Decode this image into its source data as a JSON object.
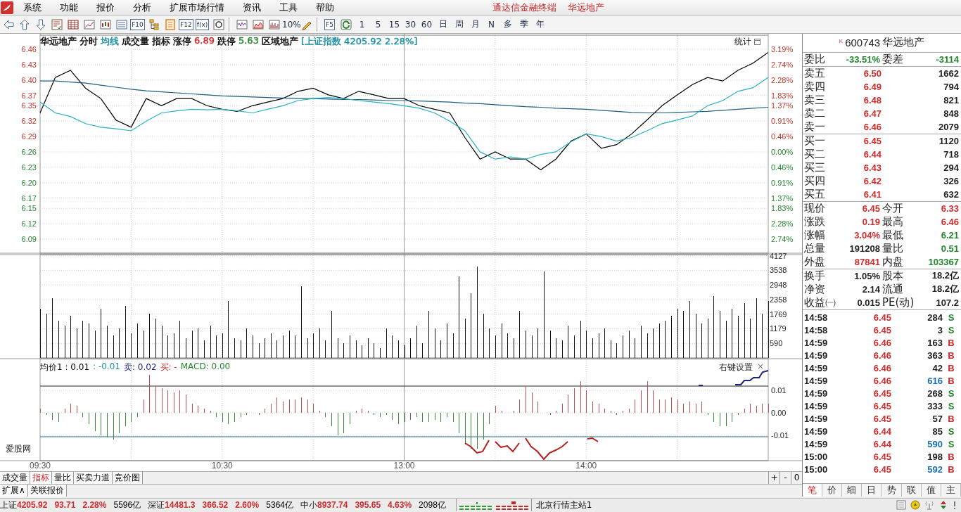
{
  "menubar": {
    "menus": [
      "系统",
      "功能",
      "报价",
      "分析",
      "扩展市场行情",
      "资讯",
      "工具",
      "帮助"
    ],
    "title": "通达信金融终端",
    "security": "华远地产"
  },
  "toolbar": {
    "items": [
      {
        "kind": "icon"
      },
      {
        "kind": "icon"
      },
      {
        "kind": "icon"
      },
      {
        "kind": "icon"
      },
      {
        "kind": "icon"
      },
      {
        "kind": "icon"
      },
      {
        "kind": "icon"
      },
      {
        "kind": "icon"
      },
      {
        "kind": "boxed",
        "text": "F10"
      },
      {
        "kind": "icon"
      },
      {
        "kind": "icon"
      },
      {
        "kind": "boxed",
        "text": "F12"
      },
      {
        "kind": "boxed",
        "text": "f(x)"
      },
      {
        "kind": "icon"
      },
      {
        "kind": "separator"
      },
      {
        "kind": "icon"
      },
      {
        "kind": "icon"
      },
      {
        "kind": "icon"
      },
      {
        "kind": "text",
        "text": "10%"
      },
      {
        "kind": "icon"
      },
      {
        "kind": "separator"
      },
      {
        "kind": "boxed",
        "text": "F5"
      },
      {
        "kind": "icon"
      },
      {
        "kind": "text",
        "text": "1"
      },
      {
        "kind": "text",
        "text": "5"
      },
      {
        "kind": "text",
        "text": "15"
      },
      {
        "kind": "text",
        "text": "30"
      },
      {
        "kind": "text",
        "text": "60"
      },
      {
        "kind": "text",
        "text": "日"
      },
      {
        "kind": "text",
        "text": "周"
      },
      {
        "kind": "text",
        "text": "月"
      },
      {
        "kind": "text",
        "text": "N"
      },
      {
        "kind": "text",
        "text": "多"
      },
      {
        "kind": "text",
        "text": "季"
      },
      {
        "kind": "text",
        "text": "年"
      }
    ]
  },
  "chart": {
    "header": [
      {
        "text": "华远地产"
      },
      {
        "text": "分时"
      },
      {
        "text": "均线",
        "color": "#1a8fa0"
      },
      {
        "text": "成交量"
      },
      {
        "text": "指标"
      },
      {
        "text": "涨停"
      },
      {
        "text": "6.89",
        "color": "#d02c2c"
      },
      {
        "text": "跌停"
      },
      {
        "text": "5.63",
        "color": "#23862d"
      },
      {
        "text": "区域地产"
      },
      {
        "text": "[上证指数 4205.92 2.28%]",
        "color": "#1a8fa0"
      }
    ],
    "stats_button": "统计",
    "price_chart": {
      "chart_data": {
        "type": "line",
        "grid": true,
        "ylim": [
          6.0626,
          6.4874
        ],
        "yticks": [
          {
            "value": 6.46,
            "label": "6.46"
          },
          {
            "value": 6.43,
            "label": "6.43"
          },
          {
            "value": 6.4,
            "label": "6.40"
          },
          {
            "value": 6.37,
            "label": "6.37"
          },
          {
            "value": 6.35,
            "label": "6.35"
          },
          {
            "value": 6.32,
            "label": "6.32"
          },
          {
            "value": 6.29,
            "label": "6.29"
          },
          {
            "value": 6.26,
            "label": "6.26"
          },
          {
            "value": 6.23,
            "label": "6.23"
          },
          {
            "value": 6.2,
            "label": "6.20"
          },
          {
            "value": 6.17,
            "label": "6.17"
          },
          {
            "value": 6.15,
            "label": "6.15"
          },
          {
            "value": 6.12,
            "label": "6.12"
          },
          {
            "value": 6.09,
            "label": "6.09"
          }
        ],
        "series": [
          {
            "color": "#000000",
            "values": [
              6.336,
              6.405,
              6.419,
              6.384,
              6.364,
              6.322,
              6.308,
              6.364,
              6.35,
              6.364,
              6.364,
              6.35,
              6.343,
              6.339,
              6.35,
              6.357,
              6.364,
              6.378,
              6.384,
              6.371,
              6.364,
              6.378,
              6.371,
              6.364,
              6.364,
              6.35,
              6.343,
              6.336,
              6.288,
              6.246,
              6.26,
              6.246,
              6.246,
              6.225,
              6.246,
              6.281,
              6.295,
              6.267,
              6.274,
              6.295,
              6.322,
              6.35,
              6.371,
              6.391,
              6.405,
              6.398,
              6.419,
              6.433,
              6.454
            ]
          },
          {
            "color": "#1f5f7f",
            "values": [
              6.398,
              6.398,
              6.396,
              6.394,
              6.39,
              6.386,
              6.382,
              6.379,
              6.377,
              6.375,
              6.373,
              6.371,
              6.369,
              6.368,
              6.367,
              6.366,
              6.365,
              6.364,
              6.364,
              6.363,
              6.362,
              6.362,
              6.361,
              6.36,
              6.36,
              6.359,
              6.358,
              6.357,
              6.355,
              6.354,
              6.352,
              6.35,
              6.348,
              6.347,
              6.345,
              6.344,
              6.343,
              6.341,
              6.339,
              6.337,
              6.336,
              6.336,
              6.337,
              6.338,
              6.339,
              6.341,
              6.343,
              6.345,
              6.347
            ]
          },
          {
            "color": "#2ab0c0",
            "values": [
              6.357,
              6.336,
              6.329,
              6.315,
              6.308,
              6.305,
              6.301,
              6.32,
              6.336,
              6.34,
              6.343,
              6.342,
              6.343,
              6.34,
              6.336,
              6.343,
              6.35,
              6.36,
              6.364,
              6.366,
              6.364,
              6.36,
              6.357,
              6.354,
              6.35,
              6.345,
              6.336,
              6.32,
              6.301,
              6.26,
              6.246,
              6.25,
              6.246,
              6.255,
              6.26,
              6.28,
              6.295,
              6.29,
              6.281,
              6.288,
              6.301,
              6.315,
              6.322,
              6.33,
              6.35,
              6.36,
              6.378,
              6.385,
              6.405
            ]
          }
        ]
      },
      "percent_labels": [
        "3.19%",
        "2.74%",
        "2.28%",
        "1.83%",
        "1.37%",
        "0.91%",
        "0.46%",
        "0.00%",
        "0.46%",
        "0.91%",
        "1.37%",
        "1.83%",
        "2.28%",
        "2.74%"
      ]
    },
    "volume_chart": {
      "chart_data": {
        "type": "bar",
        "grid": true,
        "ylim": [
          0,
          4172
        ],
        "yticks": [
          {
            "value": 4127,
            "label": "4127"
          },
          {
            "value": 3538,
            "label": "3538"
          },
          {
            "value": 2948,
            "label": "2948"
          },
          {
            "value": 2358,
            "label": "2358"
          },
          {
            "value": 1769,
            "label": "1769"
          },
          {
            "value": 1179,
            "label": "1179"
          },
          {
            "value": 590,
            "label": "590"
          }
        ],
        "values": [
          2000,
          1800,
          2400,
          1500,
          1300,
          1700,
          1200,
          1500,
          1400,
          1100,
          2000,
          1300,
          900,
          1200,
          2100,
          1000,
          1400,
          1100,
          1800,
          1600,
          1300,
          900,
          1000,
          1500,
          800,
          1100,
          1200,
          700,
          1300,
          900,
          1000,
          2300,
          800,
          700,
          1200,
          900,
          600,
          800,
          1000,
          700,
          900,
          1100,
          900,
          2900,
          800,
          1000,
          1200,
          700,
          1900,
          800,
          600,
          900,
          700,
          500,
          800,
          600,
          400,
          1200,
          900,
          700,
          500,
          800,
          1300,
          600,
          1900,
          1200,
          700,
          1400,
          1000,
          3300,
          1600,
          2600,
          3700,
          1800,
          1200,
          900,
          1400,
          1000,
          800,
          1900,
          1100,
          900,
          1200,
          3500,
          1100,
          800,
          700,
          1300,
          900,
          1500,
          1100,
          800,
          1000,
          1200,
          700,
          600,
          900,
          1100,
          800,
          1300,
          1000,
          1200,
          1400,
          1500,
          1700,
          2000,
          1900,
          2300,
          1800,
          1400,
          1600,
          2500,
          1900,
          1500,
          2000,
          1700,
          2200,
          1600,
          2400,
          1800,
          2300
        ]
      }
    },
    "indicator": {
      "legend": [
        {
          "text": "均价1 : 0.01"
        },
        {
          "text": ": -0.01",
          "color": "#1a8fa0"
        },
        {
          "text": "卖: 0.02",
          "color": "#1a237e"
        },
        {
          "text": "买: -",
          "color": "#d02c2c"
        },
        {
          "text": "MACD: 0.00",
          "color": "#23862d"
        }
      ],
      "settings": "右键设置",
      "close": "×",
      "caption": "爱股网",
      "histogram": {
        "chart_data": {
          "type": "bar",
          "grid": true,
          "ylim": [
            -0.02125,
            0.02406
          ],
          "yticks": [
            {
              "value": 0.01,
              "label": "0.01"
            },
            {
              "value": 0,
              "label": "0.00"
            },
            {
              "value": -0.01,
              "label": "-0.01"
            }
          ],
          "series": [
            {
              "color": "#c0504d",
              "values": [
                0.002,
                null,
                null,
                null,
                0.002,
                0.004,
                0.003,
                null,
                null,
                null,
                null,
                null,
                null,
                null,
                null,
                null,
                null,
                0.006,
                0.017,
                0.012,
                0.011,
                0.01,
                0.009,
                0.01,
                0.008,
                0.004,
                0.003,
                0.002,
                0.001,
                null,
                null,
                null,
                null,
                null,
                null,
                null,
                null,
                0.002,
                0.004,
                0.007,
                0.005,
                0.006,
                0.006,
                0.007,
                0.006,
                0.004,
                0.001,
                null,
                null,
                null,
                null,
                null,
                0.001,
                0.002,
                0.001,
                null,
                null,
                null,
                null,
                null,
                null,
                null,
                null,
                null,
                null,
                null,
                null,
                null,
                null,
                null,
                null,
                null,
                null,
                null,
                null,
                0.003,
                0.001,
                null,
                0.001,
                0.006,
                0.012,
                0.009,
                0.005,
                null,
                null,
                0.001,
                0.004,
                0.008,
                0.011,
                0.014,
                0.01,
                0.005,
                0.004,
                0.002,
                0.001,
                null,
                0.001,
                0.002,
                0.006,
                0.01,
                0.014,
                0.01,
                0.006,
                0.006,
                0.007,
                0.006,
                0.004,
                0.005,
                0.004,
                0.005,
                null,
                null,
                null,
                null,
                null,
                null,
                0.002,
                0.004,
                0.003,
                0.004,
                0.004
              ]
            },
            {
              "color": "#3a8a3a",
              "values": [
                null,
                -0.001,
                -0.003,
                -0.004,
                null,
                null,
                null,
                -0.002,
                -0.005,
                -0.008,
                -0.01,
                -0.011,
                -0.012,
                -0.009,
                -0.006,
                -0.004,
                -0.002,
                null,
                null,
                null,
                null,
                null,
                null,
                null,
                null,
                null,
                null,
                null,
                null,
                -0.002,
                -0.004,
                -0.005,
                -0.004,
                -0.002,
                -0.001,
                null,
                -0.001,
                null,
                null,
                null,
                null,
                null,
                null,
                null,
                null,
                null,
                null,
                -0.002,
                -0.006,
                -0.01,
                -0.009,
                -0.005,
                null,
                null,
                null,
                -0.001,
                -0.002,
                -0.001,
                -0.003,
                -0.005,
                -0.004,
                -0.003,
                -0.002,
                -0.004,
                -0.004,
                -0.003,
                -0.004,
                -0.002,
                -0.004,
                -0.009,
                -0.014,
                -0.016,
                -0.016,
                -0.012,
                -0.005,
                null,
                null,
                null,
                null,
                null,
                null,
                null,
                null,
                null,
                -0.001,
                null,
                null,
                null,
                null,
                null,
                null,
                null,
                null,
                null,
                null,
                -0.001,
                null,
                null,
                null,
                null,
                null,
                null,
                null,
                null,
                null,
                null,
                null,
                null,
                null,
                null,
                -0.001,
                -0.004,
                -0.006,
                -0.006,
                -0.004,
                -0.001,
                null,
                null,
                null,
                null,
                null
              ]
            }
          ]
        }
      },
      "time_axis": [
        "09:30",
        "10:30",
        "13:00",
        "14:00"
      ]
    },
    "tabs": [
      {
        "label": "成交量",
        "selected": false
      },
      {
        "label": "指标",
        "selected": true
      },
      {
        "label": "量比",
        "selected": false
      },
      {
        "label": "买卖力道",
        "selected": false
      },
      {
        "label": "竞价图",
        "selected": false
      }
    ],
    "zoom_buttons": [
      "+",
      "-",
      "0"
    ],
    "extra_tabs": [
      "扩展∧",
      "关联报价"
    ]
  },
  "quote": {
    "marker": "K",
    "code": "600743",
    "name": "华远地产",
    "summary": [
      {
        "label": "委比",
        "value": "-33.51%",
        "color": "#23862d"
      },
      {
        "label": "委差",
        "value": "-3114",
        "color": "#23862d"
      }
    ],
    "sells": [
      {
        "label": "卖五",
        "price": "6.50",
        "volume": "1662",
        "color": "#d02c2c"
      },
      {
        "label": "卖四",
        "price": "6.49",
        "volume": "794",
        "color": "#d02c2c"
      },
      {
        "label": "卖三",
        "price": "6.48",
        "volume": "821",
        "color": "#d02c2c"
      },
      {
        "label": "卖二",
        "price": "6.47",
        "volume": "848",
        "color": "#d02c2c"
      },
      {
        "label": "卖一",
        "price": "6.46",
        "volume": "2079",
        "color": "#d02c2c"
      }
    ],
    "buys": [
      {
        "label": "买一",
        "price": "6.45",
        "volume": "1120",
        "color": "#d02c2c"
      },
      {
        "label": "买二",
        "price": "6.44",
        "volume": "718",
        "color": "#d02c2c"
      },
      {
        "label": "买三",
        "price": "6.43",
        "volume": "294",
        "color": "#d02c2c"
      },
      {
        "label": "买四",
        "price": "6.42",
        "volume": "326",
        "color": "#d02c2c"
      },
      {
        "label": "买五",
        "price": "6.41",
        "volume": "632",
        "color": "#d02c2c"
      }
    ],
    "stats": [
      {
        "label": "现价",
        "value": "6.45",
        "color": "#d02c2c"
      },
      {
        "label": "今开",
        "value": "6.33",
        "color": "#d02c2c"
      },
      {
        "label": "涨跌",
        "value": "0.19",
        "color": "#d02c2c"
      },
      {
        "label": "最高",
        "value": "6.46",
        "color": "#d02c2c"
      },
      {
        "label": "涨幅",
        "value": "3.04%",
        "color": "#d02c2c"
      },
      {
        "label": "最低",
        "value": "6.21",
        "color": "#23862d"
      },
      {
        "label": "总量",
        "value": "191208",
        "color": "#222222"
      },
      {
        "label": "量比",
        "value": "0.51",
        "color": "#23862d"
      },
      {
        "label": "外盘",
        "value": "87841",
        "color": "#d02c2c"
      },
      {
        "label": "内盘",
        "value": "103367",
        "color": "#23862d"
      }
    ],
    "fundamentals": [
      {
        "label": "换手",
        "value": "1.05%"
      },
      {
        "label": "股本",
        "value": "18.2亿"
      },
      {
        "label": "净资",
        "value": "2.14"
      },
      {
        "label": "流通",
        "value": "18.2亿"
      },
      {
        "label": "收益㈠",
        "value": "0.015"
      },
      {
        "label": "PE(动)",
        "value": "107.2"
      }
    ],
    "trades": [
      {
        "time": "14:58",
        "price": "6.45",
        "volume": "284",
        "side": "S",
        "color": "#23862d",
        "large": false
      },
      {
        "time": "14:58",
        "price": "6.45",
        "volume": "3",
        "side": "S",
        "color": "#23862d",
        "large": false
      },
      {
        "time": "14:59",
        "price": "6.46",
        "volume": "163",
        "side": "B",
        "color": "#d02c2c",
        "large": false
      },
      {
        "time": "14:59",
        "price": "6.46",
        "volume": "363",
        "side": "B",
        "color": "#d02c2c",
        "large": false
      },
      {
        "time": "14:59",
        "price": "6.46",
        "volume": "42",
        "side": "B",
        "color": "#d02c2c",
        "large": false
      },
      {
        "time": "14:59",
        "price": "6.46",
        "volume": "616",
        "side": "B",
        "color": "#d02c2c",
        "large": true
      },
      {
        "time": "14:59",
        "price": "6.45",
        "volume": "268",
        "side": "S",
        "color": "#23862d",
        "large": false
      },
      {
        "time": "14:59",
        "price": "6.45",
        "volume": "333",
        "side": "S",
        "color": "#23862d",
        "large": false
      },
      {
        "time": "14:59",
        "price": "6.45",
        "volume": "57",
        "side": "B",
        "color": "#d02c2c",
        "large": false
      },
      {
        "time": "14:59",
        "price": "6.44",
        "volume": "85",
        "side": "S",
        "color": "#23862d",
        "large": false
      },
      {
        "time": "14:59",
        "price": "6.44",
        "volume": "590",
        "side": "S",
        "color": "#23862d",
        "large": true
      },
      {
        "time": "15:00",
        "price": "6.45",
        "volume": "198",
        "side": "B",
        "color": "#d02c2c",
        "large": false
      },
      {
        "time": "15:00",
        "price": "6.45",
        "volume": "592",
        "side": "B",
        "color": "#d02c2c",
        "large": true
      }
    ],
    "tabs": [
      {
        "label": "笔",
        "selected": true
      },
      {
        "label": "价",
        "selected": false
      },
      {
        "label": "细",
        "selected": false
      },
      {
        "label": "日",
        "selected": false
      },
      {
        "label": "势",
        "selected": false
      },
      {
        "label": "联",
        "selected": false
      },
      {
        "label": "值",
        "selected": false
      },
      {
        "label": "主",
        "selected": false
      }
    ]
  },
  "status_bar": {
    "indices": [
      {
        "name": "上证",
        "value": "4205.92",
        "change": "93.71",
        "percent": "2.28%",
        "amount": "5596亿",
        "color": "#d02c2c"
      },
      {
        "name": "深证",
        "value": "14481.3",
        "change": "366.52",
        "percent": "2.60%",
        "amount": "5364亿",
        "color": "#d02c2c"
      },
      {
        "name": "中小",
        "value": "8937.74",
        "change": "395.65",
        "percent": "4.63%",
        "amount": "2098亿",
        "color": "#d02c2c"
      }
    ],
    "server": "北京行情主站1"
  }
}
